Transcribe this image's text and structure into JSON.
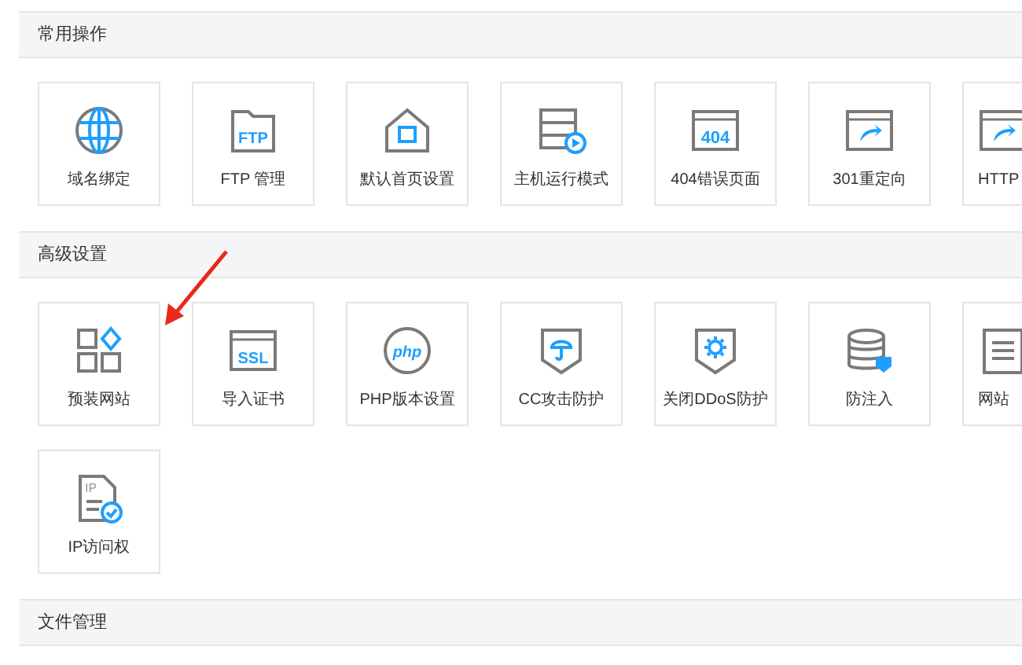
{
  "sections": [
    {
      "title": "常用操作",
      "tiles": [
        {
          "kind": "tile",
          "label": "域名绑定"
        },
        {
          "kind": "tile",
          "label": "FTP 管理",
          "icon_text": "FTP"
        },
        {
          "kind": "tile",
          "label": "默认首页设置"
        },
        {
          "kind": "tile",
          "label": "主机运行模式"
        },
        {
          "kind": "tile",
          "label": "404错误页面",
          "icon_text": "404"
        },
        {
          "kind": "tile",
          "label": "301重定向"
        },
        {
          "kind": "clipped",
          "label": "HTTP"
        }
      ]
    },
    {
      "title": "高级设置",
      "tiles": [
        {
          "kind": "tile",
          "label": "预装网站"
        },
        {
          "kind": "tile",
          "label": "导入证书",
          "icon_text": "SSL"
        },
        {
          "kind": "tile",
          "label": "PHP版本设置",
          "icon_text": "php"
        },
        {
          "kind": "tile",
          "label": "CC攻击防护"
        },
        {
          "kind": "tile",
          "label": "关闭DDoS防护"
        },
        {
          "kind": "tile",
          "label": "防注入"
        },
        {
          "kind": "clipped",
          "label": "网站"
        },
        {
          "kind": "tile",
          "label": "IP访问权",
          "icon_text": "IP"
        }
      ]
    },
    {
      "title": "文件管理"
    }
  ]
}
